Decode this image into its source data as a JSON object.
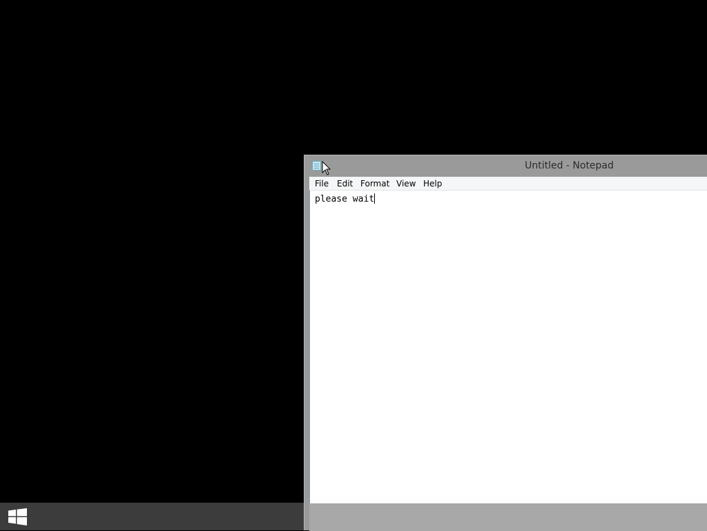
{
  "notepad": {
    "title": "Untitled - Notepad",
    "icon": "notepad-icon",
    "menu": [
      "File",
      "Edit",
      "Format",
      "View",
      "Help"
    ],
    "content": "please wait"
  },
  "taskbar": {
    "start_icon": "windows-logo-icon"
  },
  "colors": {
    "desktop": "#000000",
    "window_frame": "#9a9a9a",
    "menu_bar": "#f5f6f7",
    "edit_background": "#ffffff",
    "taskbar": "#3c3c3c"
  }
}
